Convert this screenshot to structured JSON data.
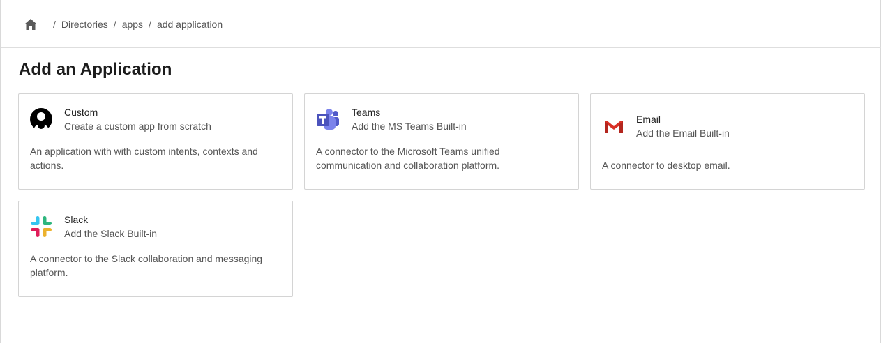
{
  "breadcrumb": {
    "home_icon": "home-icon",
    "items": [
      "Directories",
      "apps",
      "add application"
    ],
    "separator": "/"
  },
  "page": {
    "title": "Add an Application"
  },
  "cards": [
    {
      "icon": "custom-app-icon",
      "name": "Custom",
      "subtitle": "Create a custom app from scratch",
      "description": "An application with with custom intents, contexts and actions."
    },
    {
      "icon": "teams-icon",
      "name": "Teams",
      "subtitle": "Add the MS Teams Built-in",
      "description": "A connector to the Microsoft Teams unified communication and collaboration platform."
    },
    {
      "icon": "gmail-icon",
      "name": "Email",
      "subtitle": "Add the Email Built-in",
      "description": "A connector to desktop email."
    },
    {
      "icon": "slack-icon",
      "name": "Slack",
      "subtitle": "Add the Slack Built-in",
      "description": "A connector to the Slack collaboration and messaging platform."
    }
  ],
  "colors": {
    "teams_purple": "#5059C9",
    "gmail_red": "#D93025",
    "slack_blue": "#36C5F0",
    "slack_green": "#2EB67D",
    "slack_yellow": "#ECB22E",
    "slack_red": "#E01E5A"
  }
}
